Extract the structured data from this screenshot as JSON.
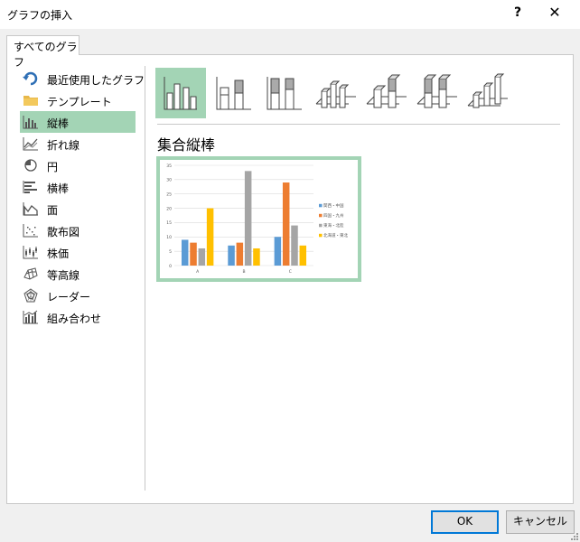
{
  "window": {
    "title": "グラフの挿入",
    "help": "?",
    "close": "✕"
  },
  "tab": {
    "label": "すべてのグラフ"
  },
  "sidebar": {
    "items": [
      {
        "label": "最近使用したグラフ",
        "icon": "recent-icon"
      },
      {
        "label": "テンプレート",
        "icon": "folder-icon"
      },
      {
        "label": "縦棒",
        "icon": "column-chart-icon",
        "selected": true
      },
      {
        "label": "折れ線",
        "icon": "line-chart-icon"
      },
      {
        "label": "円",
        "icon": "pie-chart-icon"
      },
      {
        "label": "横棒",
        "icon": "bar-chart-icon"
      },
      {
        "label": "面",
        "icon": "area-chart-icon"
      },
      {
        "label": "散布図",
        "icon": "scatter-chart-icon"
      },
      {
        "label": "株価",
        "icon": "stock-chart-icon"
      },
      {
        "label": "等高線",
        "icon": "surface-chart-icon"
      },
      {
        "label": "レーダー",
        "icon": "radar-chart-icon"
      },
      {
        "label": "組み合わせ",
        "icon": "combo-chart-icon"
      }
    ]
  },
  "subtypes": [
    {
      "icon": "clustered-column-icon",
      "selected": true
    },
    {
      "icon": "stacked-column-icon"
    },
    {
      "icon": "100-stacked-column-icon"
    },
    {
      "icon": "3d-clustered-column-icon"
    },
    {
      "icon": "3d-stacked-column-icon"
    },
    {
      "icon": "3d-100-stacked-column-icon"
    },
    {
      "icon": "3d-column-icon"
    }
  ],
  "subtype_title": "集合縦棒",
  "chart_data": {
    "type": "bar",
    "categories": [
      "A",
      "B",
      "C"
    ],
    "series": [
      {
        "name": "関西・中国",
        "color": "#5b9bd5",
        "values": [
          9,
          7,
          10
        ]
      },
      {
        "name": "四国・九州",
        "color": "#ed7d31",
        "values": [
          8,
          8,
          29
        ]
      },
      {
        "name": "東海・北陸",
        "color": "#a5a5a5",
        "values": [
          6,
          33,
          14
        ]
      },
      {
        "name": "北海道・東北",
        "color": "#ffc000",
        "values": [
          20,
          6,
          7
        ]
      }
    ],
    "yticks": [
      "0",
      "5",
      "10",
      "15",
      "20",
      "25",
      "30",
      "35"
    ],
    "ylim": [
      0,
      35
    ],
    "grid": true,
    "legend": "right"
  },
  "buttons": {
    "ok": "OK",
    "cancel": "キャンセル"
  },
  "colors": {
    "accent": "#a3d4b5",
    "focus": "#0078d7"
  }
}
